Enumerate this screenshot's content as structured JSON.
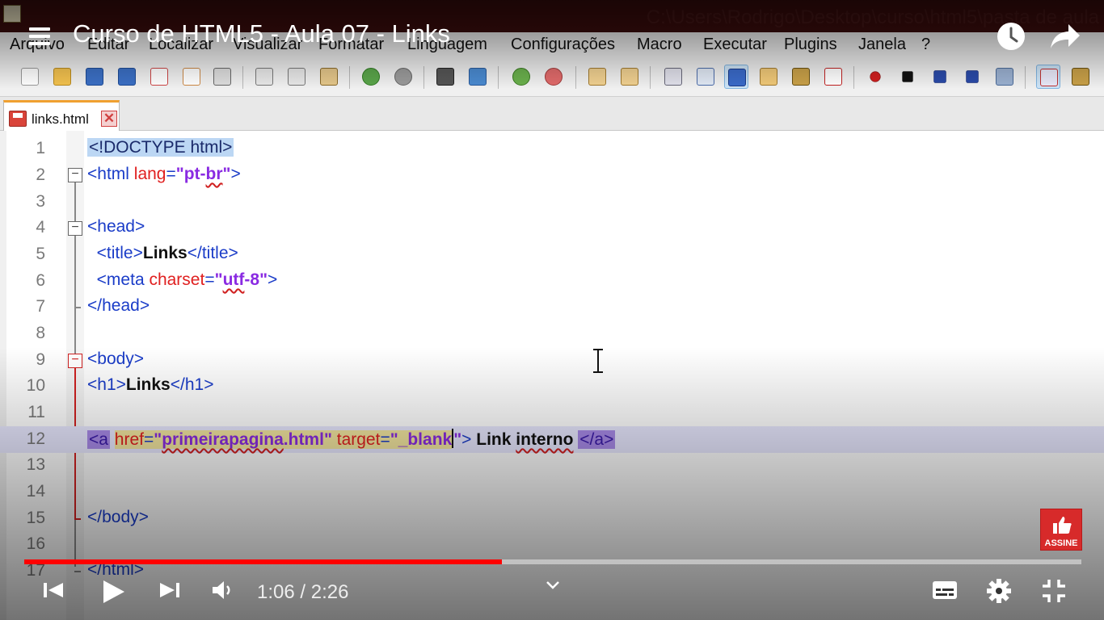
{
  "notepad": {
    "titlebar_path": "C:\\Users\\Rodrigo\\Desktop\\curso\\html5\\pasta de aula",
    "menus": [
      "Arquivo",
      "Editar",
      "Localizar",
      "Visualizar",
      "Formatar",
      "Linguagem",
      "Configurações",
      "Macro",
      "Executar",
      "Plugins",
      "Janela",
      "?"
    ],
    "tab": {
      "filename": "links.html",
      "close_symbol": "✕"
    },
    "accent": "#d02020"
  },
  "code_lines": [
    {
      "n": "1",
      "text": "<!DOCTYPE html>"
    },
    {
      "n": "2",
      "text": "<html lang=\"pt-br\">"
    },
    {
      "n": "3",
      "text": ""
    },
    {
      "n": "4",
      "text": "<head>"
    },
    {
      "n": "5",
      "text": "  <title>Links</title>"
    },
    {
      "n": "6",
      "text": "  <meta charset=\"utf-8\">"
    },
    {
      "n": "7",
      "text": "</head>"
    },
    {
      "n": "8",
      "text": ""
    },
    {
      "n": "9",
      "text": "<body>"
    },
    {
      "n": "10",
      "text": "<h1>Links</h1>"
    },
    {
      "n": "11",
      "text": ""
    },
    {
      "n": "12",
      "text": "<a href=\"primeirapagina.html\" target=\"_blank\"> Link interno </a>"
    },
    {
      "n": "13",
      "text": ""
    },
    {
      "n": "14",
      "text": ""
    },
    {
      "n": "15",
      "text": "</body>"
    },
    {
      "n": "16",
      "text": ""
    },
    {
      "n": "17",
      "text": "</html>"
    }
  ],
  "video": {
    "title": "Curso de HTML5 - Aula 07 - Links",
    "current_time": "1:06",
    "separator": "/",
    "duration": "2:26",
    "progress_fraction": 0.452,
    "subscribe_label": "ASSINE",
    "icons": [
      "menu-icon",
      "clock-icon",
      "share-icon",
      "previous-icon",
      "play-icon",
      "next-icon",
      "volume-icon",
      "chevron-down-icon",
      "subtitles-icon",
      "settings-icon",
      "exit-fullscreen-icon"
    ]
  }
}
